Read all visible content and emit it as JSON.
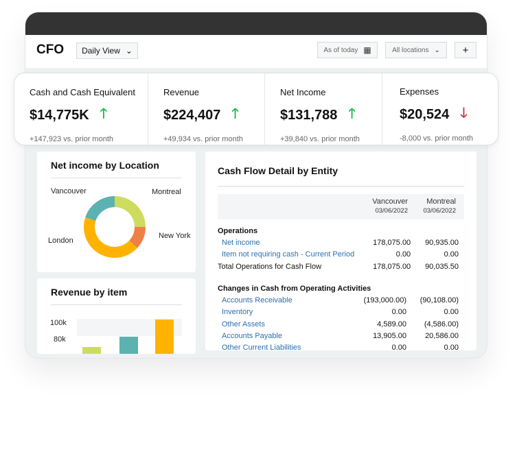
{
  "header": {
    "title": "CFO",
    "view": "Daily View",
    "date_filter": "As of today",
    "location_filter": "All locations",
    "add": "+"
  },
  "kpis": [
    {
      "label": "Cash and Cash Equivalent",
      "value": "$14,775K",
      "trend": "up",
      "change": "+147,923 vs. prior month"
    },
    {
      "label": "Revenue",
      "value": "$224,407",
      "trend": "up",
      "change": "+49,934 vs. prior month"
    },
    {
      "label": "Net Income",
      "value": "$131,788",
      "trend": "up",
      "change": "+39,840 vs. prior month"
    },
    {
      "label": "Expenses",
      "value": "$20,524",
      "trend": "down",
      "change": "-8,000 vs. prior month"
    }
  ],
  "colors": {
    "up": "#1fc04a",
    "down": "#d23b4a",
    "link": "#2a6fb0",
    "montreal": "#cddc5f",
    "new_york": "#f07f45",
    "london": "#ffb300",
    "vancouver": "#5cb2b1"
  },
  "net_income": {
    "title": "Net income by Location",
    "slices": [
      {
        "label": "Montreal",
        "share": 25,
        "color": "#cddc5f"
      },
      {
        "label": "New York",
        "share": 12,
        "color": "#f07f45"
      },
      {
        "label": "London",
        "share": 43,
        "color": "#ffb300"
      },
      {
        "label": "Vancouver",
        "share": 20,
        "color": "#5cb2b1"
      }
    ]
  },
  "revenue": {
    "title": "Revenue by item",
    "ticks": [
      "100k",
      "80k"
    ],
    "bars": [
      {
        "value": 72,
        "color": "#cddc5f"
      },
      {
        "value": 84,
        "color": "#5cb2b1"
      },
      {
        "value": 105,
        "color": "#ffb300"
      }
    ]
  },
  "cashflow": {
    "title": "Cash Flow Detail by Entity",
    "columns": [
      {
        "name": "Vancouver",
        "date": "03/06/2022"
      },
      {
        "name": "Montreal",
        "date": "03/06/2022"
      }
    ],
    "sections": [
      {
        "heading": "Operations",
        "rows": [
          {
            "label": "Net income",
            "link": true,
            "v": "178,075.00",
            "m": "90,935.00"
          },
          {
            "label": "Item not requiring cash - Current Period",
            "link": true,
            "v": "0.00",
            "m": "0.00"
          },
          {
            "label": "Total Operations for Cash Flow",
            "link": false,
            "v": "178,075.00",
            "m": "90,035.50"
          }
        ]
      },
      {
        "heading": "Changes in Cash from Operating Activities",
        "rows": [
          {
            "label": "Accounts Receivable",
            "link": true,
            "v": "(193,000.00)",
            "m": "(90,108.00)"
          },
          {
            "label": "Inventory",
            "link": true,
            "v": "0.00",
            "m": "0.00"
          },
          {
            "label": "Other Assets",
            "link": true,
            "v": "4,589.00",
            "m": "(4,586.00)"
          },
          {
            "label": "Accounts Payable",
            "link": true,
            "v": "13,905.00",
            "m": "20,586.00"
          },
          {
            "label": "Other Current Liabilities",
            "link": true,
            "v": "0.00",
            "m": "0.00"
          }
        ]
      }
    ]
  }
}
